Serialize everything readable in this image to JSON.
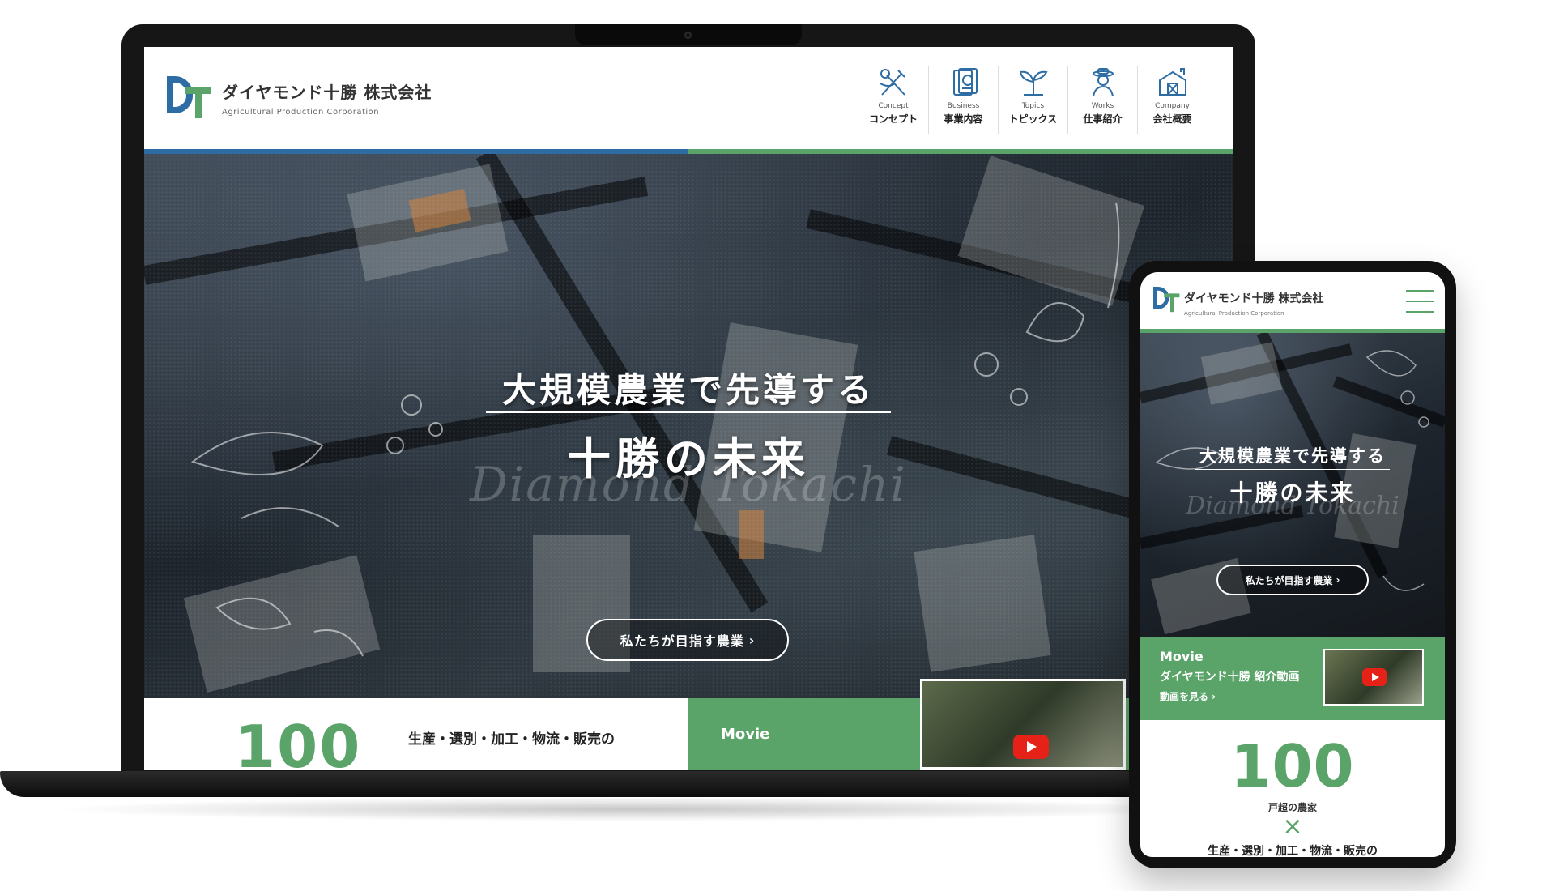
{
  "site": {
    "company_name": "ダイヤモンド十勝 株式会社",
    "company_sub": "Agricultural Production Corporation"
  },
  "nav": [
    {
      "en": "Concept",
      "ja": "コンセプト",
      "icon": "tools-icon"
    },
    {
      "en": "Business",
      "ja": "事業内容",
      "icon": "seed-packet-icon"
    },
    {
      "en": "Topics",
      "ja": "トピックス",
      "icon": "sprout-icon"
    },
    {
      "en": "Works",
      "ja": "仕事紹介",
      "icon": "farmer-icon"
    },
    {
      "en": "Company",
      "ja": "会社概要",
      "icon": "barn-icon"
    }
  ],
  "hero": {
    "title_line1": "大規模農業で先導する",
    "title_line2": "十勝の未来",
    "script_text": "Diamond Tokachi",
    "button_label": "私たちが目指す農業",
    "button_chevron": "›"
  },
  "stats": {
    "number": "100",
    "number_caption": "戸超の農家",
    "times_symbol": "×",
    "line_text": "生産・選別・加工・物流・販売の"
  },
  "movie": {
    "label": "Movie",
    "title": "ダイヤモンド十勝 紹介動画",
    "link": "動画を見る ›"
  },
  "colors": {
    "brand_green": "#5aa469",
    "brand_blue": "#2e6da4",
    "youtube_red": "#e62117"
  }
}
